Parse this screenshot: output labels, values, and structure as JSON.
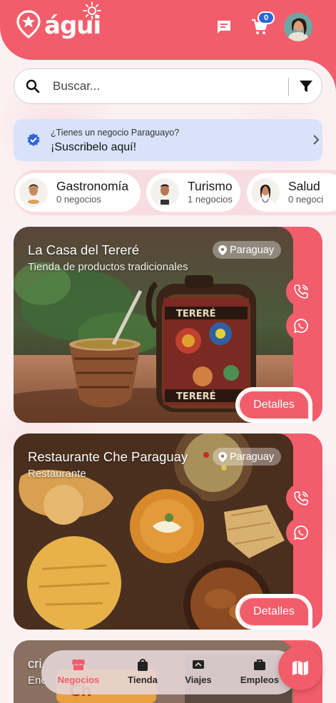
{
  "app": {
    "logo_text": "águi"
  },
  "header": {
    "cart_count": "0"
  },
  "search": {
    "placeholder": "Buscar..."
  },
  "promo": {
    "question": "¿Tienes un negocio Paraguayo?",
    "cta": "¡Suscribelo aquí!"
  },
  "categories": [
    {
      "name": "Gastronomía",
      "count": "0 negocios"
    },
    {
      "name": "Turismo",
      "count": "1 negocios"
    },
    {
      "name": "Salud",
      "count": "0 negoci"
    }
  ],
  "cards": [
    {
      "title": "La Casa del Tereré",
      "subtitle": "Tienda de productos tradicionales",
      "location": "Paraguay",
      "details_label": "Detalles"
    },
    {
      "title": "Restaurante Che Paraguay",
      "subtitle": "Restaurante",
      "location": "Paraguay",
      "details_label": "Detalles"
    },
    {
      "title": "cri",
      "subtitle": "Enc"
    }
  ],
  "nav": {
    "items": [
      "Negocios",
      "Tienda",
      "Viajes",
      "Empleos"
    ],
    "active": "Negocios"
  },
  "colors": {
    "primary": "#f25d6b",
    "promo_bg": "#d8e3fa",
    "badge": "#2f66d6"
  }
}
